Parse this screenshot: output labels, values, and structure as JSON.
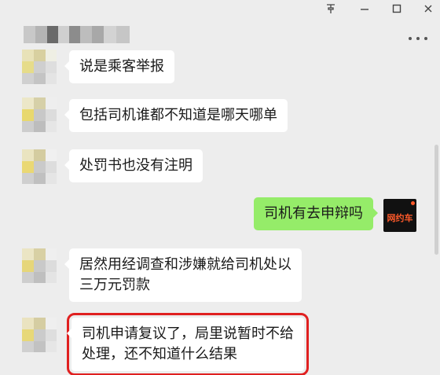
{
  "window": {
    "pin_icon": "pin-icon",
    "minimize_icon": "minimize-icon",
    "maximize_icon": "maximize-icon",
    "close_icon": "close-icon",
    "more_icon": "more-icon"
  },
  "messages": [
    {
      "side": "left",
      "text": "说是乘客举报"
    },
    {
      "side": "left",
      "text": "包括司机谁都不知道是哪天哪单"
    },
    {
      "side": "left",
      "text": "处罚书也没有注明"
    },
    {
      "side": "right",
      "text": "司机有去申辩吗"
    },
    {
      "side": "left",
      "text": "居然用经调查和涉嫌就给司机处以\n三万元罚款"
    },
    {
      "side": "left",
      "text": "司机申请复议了，局里说暂时不给\n处理，还不知道什么结果"
    }
  ],
  "self_avatar": {
    "label": "网约车"
  },
  "colors": {
    "background": "#ededed",
    "received_bubble": "#ffffff",
    "sent_bubble": "#95ec69",
    "highlight_border": "#e02020"
  }
}
